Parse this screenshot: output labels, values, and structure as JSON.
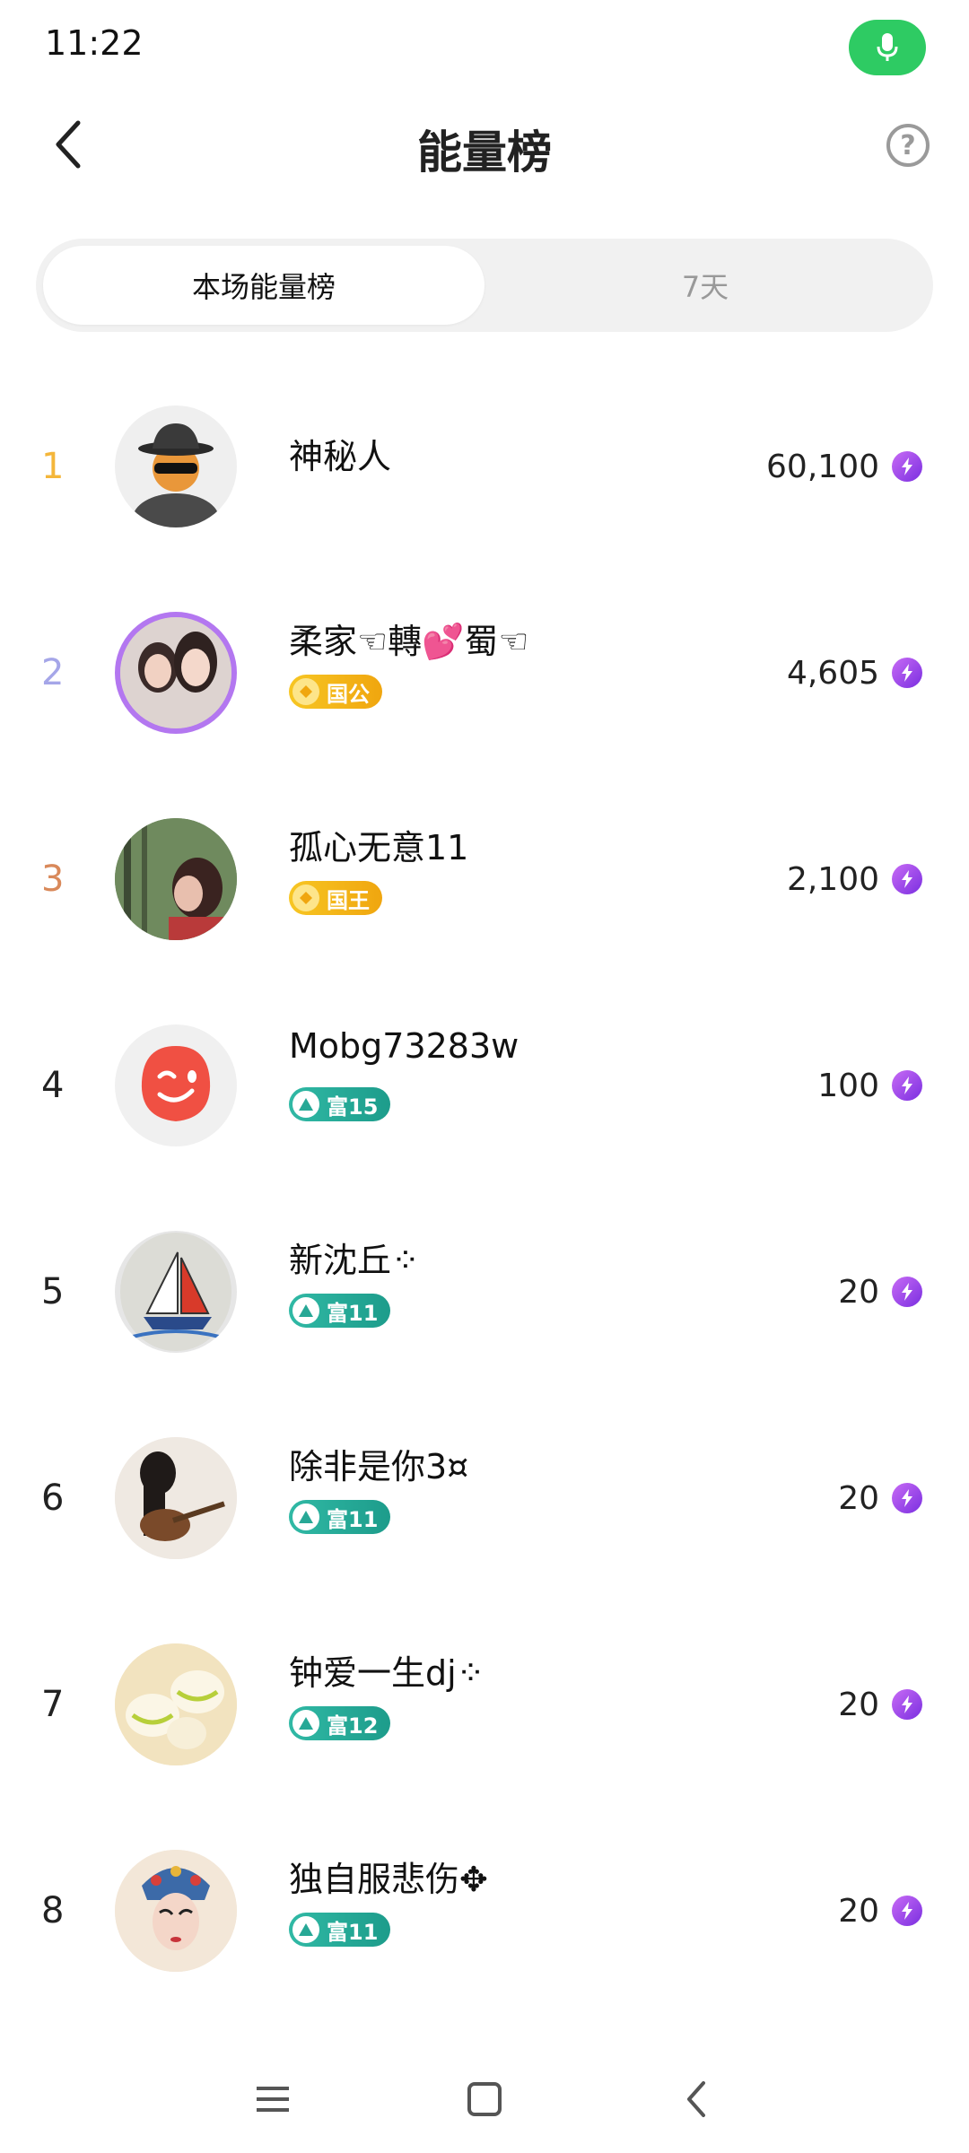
{
  "status": {
    "time": "11:22"
  },
  "header": {
    "title": "能量榜",
    "back_icon": "chevron-left-icon",
    "help_label": "?"
  },
  "tabs": [
    {
      "label": "本场能量榜",
      "active": true
    },
    {
      "label": "7天",
      "active": false
    }
  ],
  "rows": [
    {
      "rank": "1",
      "name": "神秘人",
      "score": "60,100",
      "badge": null
    },
    {
      "rank": "2",
      "name": "柔家☜轉💕蜀☜",
      "score": "4,605",
      "badge": {
        "label": "国公",
        "style": "gold"
      }
    },
    {
      "rank": "3",
      "name": "孤心无意11",
      "score": "2,100",
      "badge": {
        "label": "国王",
        "style": "gold"
      }
    },
    {
      "rank": "4",
      "name": "Mobg73283w",
      "score": "100",
      "badge": {
        "label": "富15",
        "style": "teal"
      }
    },
    {
      "rank": "5",
      "name": "新沈丘⁘",
      "score": "20",
      "badge": {
        "label": "富11",
        "style": "teal"
      }
    },
    {
      "rank": "6",
      "name": "除非是你3¤",
      "score": "20",
      "badge": {
        "label": "富11",
        "style": "teal"
      }
    },
    {
      "rank": "7",
      "name": "钟爱一生dj⁘",
      "score": "20",
      "badge": {
        "label": "富12",
        "style": "teal"
      }
    },
    {
      "rank": "8",
      "name": "独自服悲伤✥",
      "score": "20",
      "badge": {
        "label": "富11",
        "style": "teal"
      }
    }
  ],
  "colors": {
    "accent_green": "#2ecb63",
    "gold_badge": "#f4b63a",
    "teal_badge": "#30b9a5",
    "energy_purple": "#8a3ee6"
  }
}
